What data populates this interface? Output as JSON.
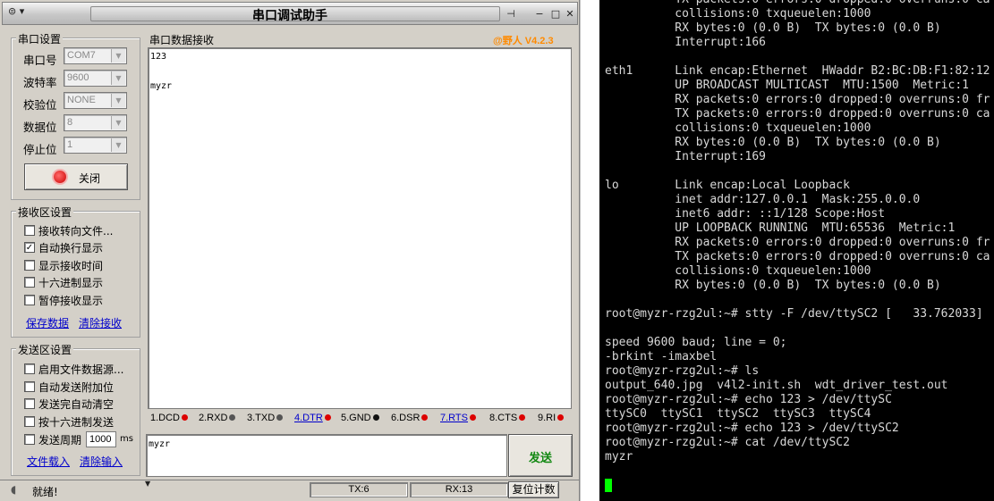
{
  "app": {
    "title": "串口调试助手",
    "brand": "@野人 V4.2.3",
    "colors": {
      "brand": "#ff8a00",
      "link": "#0000cc",
      "led_red": "#dd0000",
      "led_black": "#111111"
    }
  },
  "port_settings": {
    "title": "串口设置",
    "fields": [
      {
        "label": "串口号",
        "value": "COM7"
      },
      {
        "label": "波特率",
        "value": "9600"
      },
      {
        "label": "校验位",
        "value": "NONE"
      },
      {
        "label": "数据位",
        "value": "8"
      },
      {
        "label": "停止位",
        "value": "1"
      }
    ],
    "close_button": "关闭"
  },
  "receive_settings": {
    "title": "接收区设置",
    "options": [
      {
        "label": "接收转向文件...",
        "checked": false
      },
      {
        "label": "自动换行显示",
        "checked": true
      },
      {
        "label": "显示接收时间",
        "checked": false
      },
      {
        "label": "十六进制显示",
        "checked": false
      },
      {
        "label": "暂停接收显示",
        "checked": false
      }
    ],
    "save": "保存数据",
    "clear": "清除接收"
  },
  "send_settings": {
    "title": "发送区设置",
    "options": [
      {
        "label": "启用文件数据源...",
        "checked": false
      },
      {
        "label": "自动发送附加位",
        "checked": false
      },
      {
        "label": "发送完自动清空",
        "checked": false
      },
      {
        "label": "按十六进制发送",
        "checked": false
      },
      {
        "label": "发送周期",
        "checked": false
      }
    ],
    "period_value": "1000",
    "period_unit": "ms",
    "load_file": "文件载入",
    "clear_input": "清除输入"
  },
  "receive_area": {
    "title": "串口数据接收",
    "line1": "123",
    "line2": "myzr"
  },
  "signals": [
    {
      "label": "1.DCD",
      "led": "red",
      "link": false
    },
    {
      "label": "2.RXD",
      "led": "gray",
      "link": false
    },
    {
      "label": "3.TXD",
      "led": "gray",
      "link": false
    },
    {
      "label": "4.DTR",
      "led": "red",
      "link": true
    },
    {
      "label": "5.GND",
      "led": "black",
      "link": false
    },
    {
      "label": "6.DSR",
      "led": "red",
      "link": false
    },
    {
      "label": "7.RTS",
      "led": "red",
      "link": true
    },
    {
      "label": "8.CTS",
      "led": "red",
      "link": false
    },
    {
      "label": "9.RI",
      "led": "red",
      "link": false
    }
  ],
  "send_area": {
    "value": "myzr",
    "send_button": "发送"
  },
  "status_bar": {
    "status": "就绪!",
    "tx": "TX:6",
    "rx": "RX:13",
    "reset": "复位计数"
  },
  "terminal": {
    "lines": [
      "          TX packets:0 errors:0 dropped:0 overruns:0 ca",
      "          collisions:0 txqueuelen:1000",
      "          RX bytes:0 (0.0 B)  TX bytes:0 (0.0 B)",
      "          Interrupt:166",
      "",
      "eth1      Link encap:Ethernet  HWaddr B2:BC:DB:F1:82:12",
      "          UP BROADCAST MULTICAST  MTU:1500  Metric:1",
      "          RX packets:0 errors:0 dropped:0 overruns:0 fr",
      "          TX packets:0 errors:0 dropped:0 overruns:0 ca",
      "          collisions:0 txqueuelen:1000",
      "          RX bytes:0 (0.0 B)  TX bytes:0 (0.0 B)",
      "          Interrupt:169",
      "",
      "lo        Link encap:Local Loopback",
      "          inet addr:127.0.0.1  Mask:255.0.0.0",
      "          inet6 addr: ::1/128 Scope:Host",
      "          UP LOOPBACK RUNNING  MTU:65536  Metric:1",
      "          RX packets:0 errors:0 dropped:0 overruns:0 fr",
      "          TX packets:0 errors:0 dropped:0 overruns:0 ca",
      "          collisions:0 txqueuelen:1000",
      "          RX bytes:0 (0.0 B)  TX bytes:0 (0.0 B)",
      "",
      "root@myzr-rzg2ul:~# stty -F /dev/ttySC2 [   33.762033]",
      "",
      "speed 9600 baud; line = 0;",
      "-brkint -imaxbel",
      "root@myzr-rzg2ul:~# ls",
      "output_640.jpg  v4l2-init.sh  wdt_driver_test.out",
      "root@myzr-rzg2ul:~# echo 123 > /dev/ttySC",
      "ttySC0  ttySC1  ttySC2  ttySC3  ttySC4",
      "root@myzr-rzg2ul:~# echo 123 > /dev/ttySC2",
      "root@myzr-rzg2ul:~# cat /dev/ttySC2",
      "myzr"
    ],
    "cursor_color": "#00ff00"
  }
}
